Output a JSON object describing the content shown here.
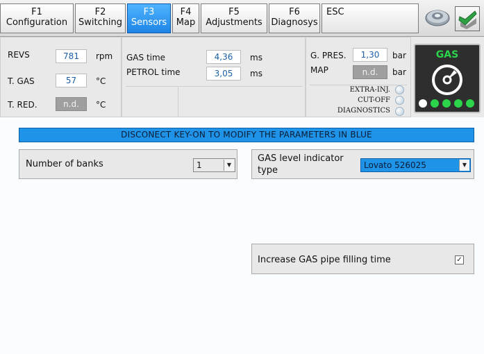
{
  "tabs": [
    {
      "key": "F1",
      "label": "Configuration"
    },
    {
      "key": "F2",
      "label": "Switching"
    },
    {
      "key": "F3",
      "label": "Sensors"
    },
    {
      "key": "F4",
      "label": "Map"
    },
    {
      "key": "F5",
      "label": "Adjustments"
    },
    {
      "key": "F6",
      "label": "Diagnosys"
    },
    {
      "key": "ESC",
      "label": ""
    }
  ],
  "sensors": {
    "revs": {
      "label": "REVS",
      "value": "781",
      "unit": "rpm"
    },
    "t_gas": {
      "label": "T. GAS",
      "value": "57",
      "unit": "°C"
    },
    "t_red": {
      "label": "T. RED.",
      "value": "n.d.",
      "unit": "°C"
    },
    "gas_time": {
      "label": "GAS time",
      "value": "4,36",
      "unit": "ms"
    },
    "petrol_time": {
      "label": "PETROL time",
      "value": "3,05",
      "unit": "ms"
    },
    "g_pres": {
      "label": "G. PRES.",
      "value": "1,30",
      "unit": "bar"
    },
    "map": {
      "label": "MAP",
      "value": "n.d.",
      "unit": "bar"
    },
    "indicators": [
      "EXTRA-INJ.",
      "CUT-OFF",
      "DIAGNOSTICS"
    ],
    "gas_label": "GAS",
    "gas_color": "#2bd44a"
  },
  "main": {
    "banner": "DISCONECT KEY-ON TO MODIFY THE PARAMETERS IN BLUE",
    "banks_label": "Number of banks",
    "banks_value": "1",
    "gas_level_label_1": "GAS level indicator",
    "gas_level_label_2": "type",
    "gas_level_value": "Lovato 526025",
    "filling_label": "Increase GAS pipe filling time",
    "filling_checked": "✓"
  },
  "colors": {
    "accent": "#1f93e8",
    "active_tab": "#2b8ff0"
  }
}
